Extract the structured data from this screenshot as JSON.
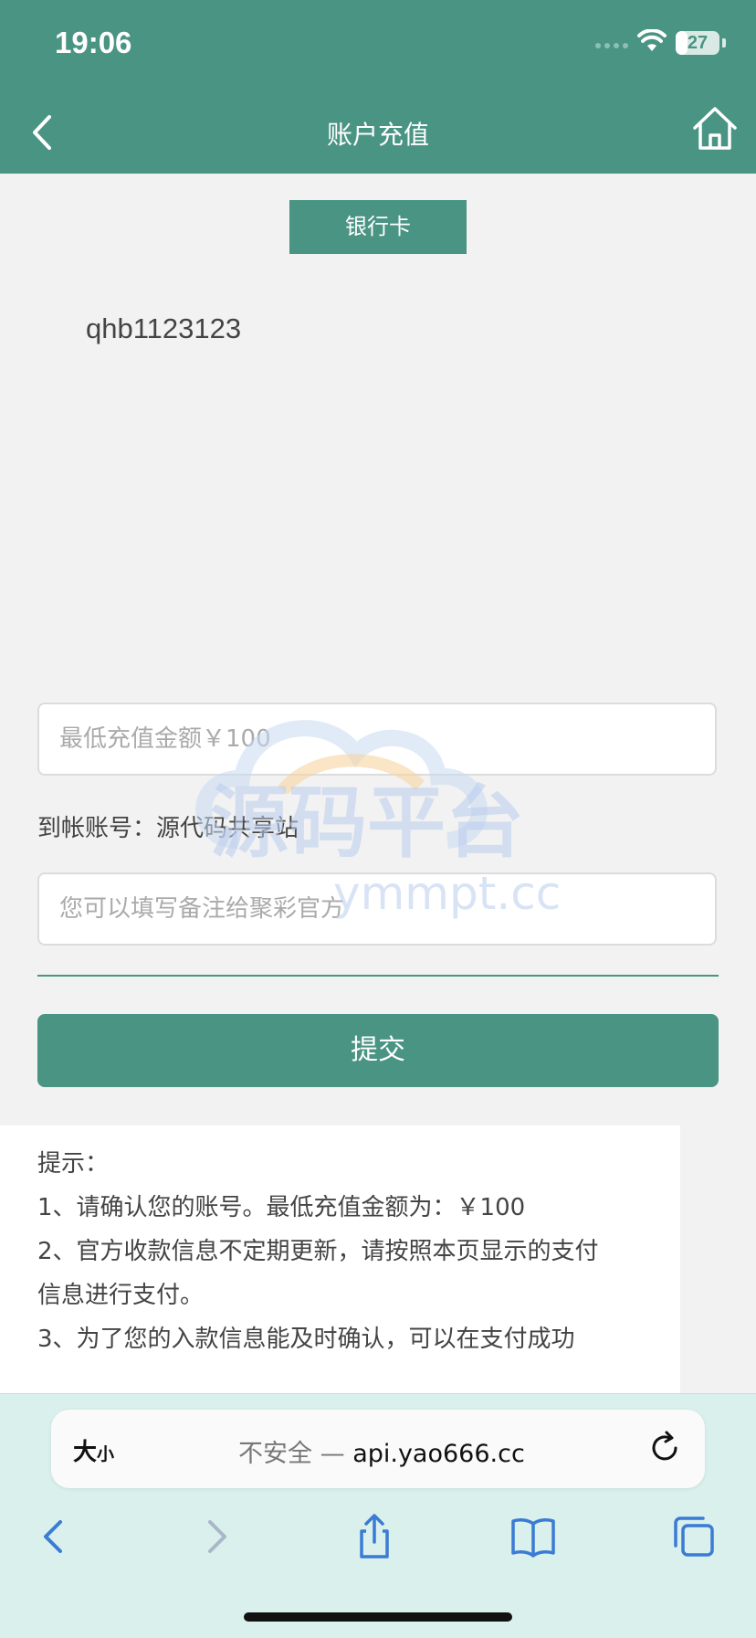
{
  "status_bar": {
    "time": "19:06",
    "battery": "27",
    "battery_level": 0.27
  },
  "nav": {
    "title": "账户充值"
  },
  "tabs": {
    "bank_card": "银行卡"
  },
  "account": {
    "username": "qhb1123123"
  },
  "form": {
    "amount_placeholder": "最低充值金额￥100",
    "receive_label": "到帐账号：",
    "receive_value": "源代码共享站",
    "note_placeholder": "您可以填写备注给聚彩官方",
    "submit_label": "提交"
  },
  "tips": {
    "title": "提示：",
    "items": [
      "1、请确认您的账号。最低充值金额为：￥100",
      "2、官方收款信息不定期更新，请按照本页显示的支付",
      "信息进行支付。",
      "3、为了您的入款信息能及时确认，可以在支付成功"
    ]
  },
  "watermark": {
    "text_cn": "源码平台",
    "text_url": "ymmpt.cc"
  },
  "browser": {
    "text_size_big": "大",
    "text_size_small": "小",
    "insecure_label": "不安全 —",
    "url": "api.yao666.cc"
  },
  "colors": {
    "primary": "#4a9484",
    "browser_bg": "#d9f0ec",
    "toolbar_icon": "#3a7bd5"
  },
  "icons": {
    "nav_back": "chevron-left-icon",
    "nav_home": "home-icon",
    "reload": "reload-icon",
    "back": "chevron-left-icon",
    "forward": "chevron-right-icon",
    "share": "share-icon",
    "bookmarks": "book-icon",
    "tabs": "tabs-icon"
  }
}
